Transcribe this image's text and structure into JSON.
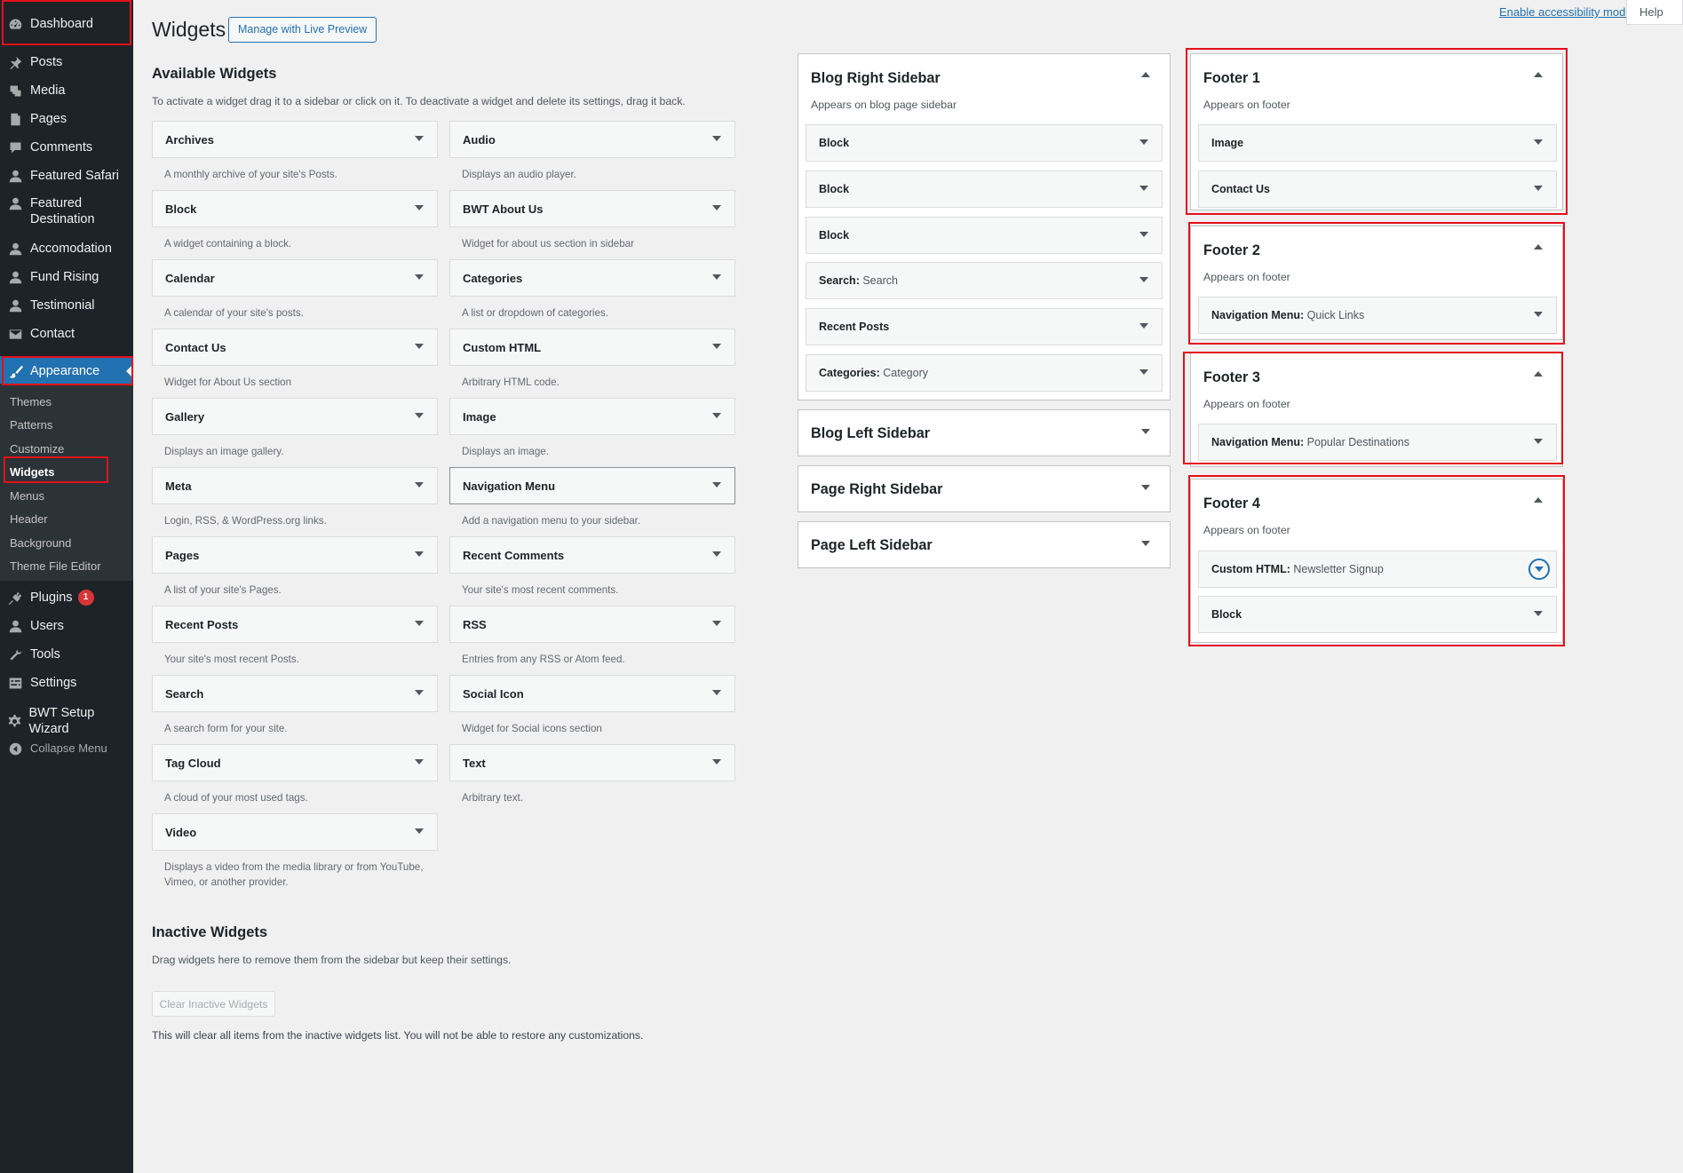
{
  "admin_menu": {
    "dashboard": "Dashboard",
    "posts": "Posts",
    "media": "Media",
    "pages": "Pages",
    "comments": "Comments",
    "featured_safari": "Featured Safari",
    "featured_destination_line1": "Featured",
    "featured_destination_line2": "Destination",
    "accomodation": "Accomodation",
    "fund_rising": "Fund Rising",
    "testimonial": "Testimonial",
    "contact": "Contact",
    "appearance": "Appearance",
    "submenu": [
      "Themes",
      "Patterns",
      "Customize",
      "Widgets",
      "Menus",
      "Header",
      "Background",
      "Theme File Editor"
    ],
    "plugins": "Plugins",
    "plugins_badge": "1",
    "users": "Users",
    "tools": "Tools",
    "settings": "Settings",
    "bwt_setup_wizard": "BWT Setup Wizard",
    "collapse_menu": "Collapse Menu"
  },
  "top_right": {
    "accessibility_link": "Enable accessibility mode",
    "help": "Help"
  },
  "header": {
    "title": "Widgets",
    "live_preview_button": "Manage with Live Preview"
  },
  "available": {
    "title": "Available Widgets",
    "description": "To activate a widget drag it to a sidebar or click on it. To deactivate a widget and delete its settings, drag it back.",
    "widgets": [
      {
        "title": "Archives",
        "desc": "A monthly archive of your site's Posts."
      },
      {
        "title": "Audio",
        "desc": "Displays an audio player."
      },
      {
        "title": "Block",
        "desc": "A widget containing a block."
      },
      {
        "title": "BWT About Us",
        "desc": "Widget for about us section in sidebar"
      },
      {
        "title": "Calendar",
        "desc": "A calendar of your site's posts."
      },
      {
        "title": "Categories",
        "desc": "A list or dropdown of categories."
      },
      {
        "title": "Contact Us",
        "desc": "Widget for About Us section"
      },
      {
        "title": "Custom HTML",
        "desc": "Arbitrary HTML code."
      },
      {
        "title": "Gallery",
        "desc": "Displays an image gallery."
      },
      {
        "title": "Image",
        "desc": "Displays an image."
      },
      {
        "title": "Meta",
        "desc": "Login, RSS, & WordPress.org links."
      },
      {
        "title": "Navigation Menu",
        "desc": "Add a navigation menu to your sidebar."
      },
      {
        "title": "Pages",
        "desc": "A list of your site's Pages."
      },
      {
        "title": "Recent Comments",
        "desc": "Your site's most recent comments."
      },
      {
        "title": "Recent Posts",
        "desc": "Your site's most recent Posts."
      },
      {
        "title": "RSS",
        "desc": "Entries from any RSS or Atom feed."
      },
      {
        "title": "Search",
        "desc": "A search form for your site."
      },
      {
        "title": "Social Icon",
        "desc": "Widget for Social icons section"
      },
      {
        "title": "Tag Cloud",
        "desc": "A cloud of your most used tags."
      },
      {
        "title": "Text",
        "desc": "Arbitrary text."
      },
      {
        "title": "Video",
        "desc_line1": "Displays a video from the media library or from YouTube,",
        "desc_line2": "Vimeo, or another provider."
      }
    ]
  },
  "inactive": {
    "title": "Inactive Widgets",
    "description": "Drag widgets here to remove them from the sidebar but keep their settings.",
    "clear_button": "Clear Inactive Widgets",
    "clear_description": "This will clear all items from the inactive widgets list. You will not be able to restore any customizations."
  },
  "sidebars": {
    "blog_right": {
      "title": "Blog Right Sidebar",
      "desc": "Appears on blog page sidebar",
      "widgets": [
        {
          "title": "Block",
          "subtitle": ""
        },
        {
          "title": "Block",
          "subtitle": ""
        },
        {
          "title": "Block",
          "subtitle": ""
        },
        {
          "title": "Search:",
          "subtitle": "Search"
        },
        {
          "title": "Recent Posts",
          "subtitle": ""
        },
        {
          "title": "Categories:",
          "subtitle": "Category"
        }
      ]
    },
    "blog_left": {
      "title": "Blog Left Sidebar"
    },
    "page_right": {
      "title": "Page Right Sidebar"
    },
    "page_left": {
      "title": "Page Left Sidebar"
    },
    "footer1": {
      "title": "Footer 1",
      "desc": "Appears on footer",
      "widgets": [
        {
          "title": "Image",
          "subtitle": ""
        },
        {
          "title": "Contact Us",
          "subtitle": ""
        }
      ]
    },
    "footer2": {
      "title": "Footer 2",
      "desc": "Appears on footer",
      "widgets": [
        {
          "title": "Navigation Menu:",
          "subtitle": "Quick Links"
        }
      ]
    },
    "footer3": {
      "title": "Footer 3",
      "desc": "Appears on footer",
      "widgets": [
        {
          "title": "Navigation Menu:",
          "subtitle": "Popular Destinations"
        }
      ]
    },
    "footer4": {
      "title": "Footer 4",
      "desc": "Appears on footer",
      "widgets": [
        {
          "title": "Custom HTML:",
          "subtitle": "Newsletter Signup"
        },
        {
          "title": "Block",
          "subtitle": ""
        }
      ]
    }
  },
  "colors": {
    "menu_bg": "#1d2327",
    "accent": "#2271b1",
    "annotation_red": "#e3101a",
    "badge_red": "#d63638"
  }
}
